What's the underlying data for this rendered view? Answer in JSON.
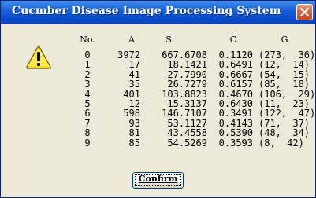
{
  "window": {
    "title": "Cucmber Disease Image Processing System"
  },
  "icons": {
    "dialog": "warning-icon",
    "close": "close-icon"
  },
  "colors": {
    "titlebar": "#0a4fcf",
    "close": "#d8603a",
    "background": "#ece9d8"
  },
  "table": {
    "headers": {
      "no": "No.",
      "a": "A",
      "s": "S",
      "c": "C",
      "g": "G"
    },
    "rows": [
      {
        "no": "0",
        "a": "3972",
        "s": "667.6708",
        "c": "0.1120",
        "g": "(273,  36)"
      },
      {
        "no": "1",
        "a": "17",
        "s": "18.1421",
        "c": "0.6491",
        "g": "(12,  14)"
      },
      {
        "no": "2",
        "a": "41",
        "s": "27.7990",
        "c": "0.6667",
        "g": "(54,  15)"
      },
      {
        "no": "3",
        "a": "35",
        "s": "26.7279",
        "c": "0.6157",
        "g": "(85,  18)"
      },
      {
        "no": "4",
        "a": "401",
        "s": "103.8823",
        "c": "0.4670",
        "g": "(106,  29)"
      },
      {
        "no": "5",
        "a": "12",
        "s": "15.3137",
        "c": "0.6430",
        "g": "(11,  23)"
      },
      {
        "no": "6",
        "a": "598",
        "s": "146.7107",
        "c": "0.3491",
        "g": "(122,  47)"
      },
      {
        "no": "7",
        "a": "93",
        "s": "53.1127",
        "c": "0.4143",
        "g": "(71,  37)"
      },
      {
        "no": "8",
        "a": "81",
        "s": "43.4558",
        "c": "0.5390",
        "g": "(48,  34)"
      },
      {
        "no": "9",
        "a": "85",
        "s": "54.5269",
        "c": "0.3593",
        "g": "(8,  42)"
      }
    ]
  },
  "buttons": {
    "confirm": "Confirm"
  }
}
